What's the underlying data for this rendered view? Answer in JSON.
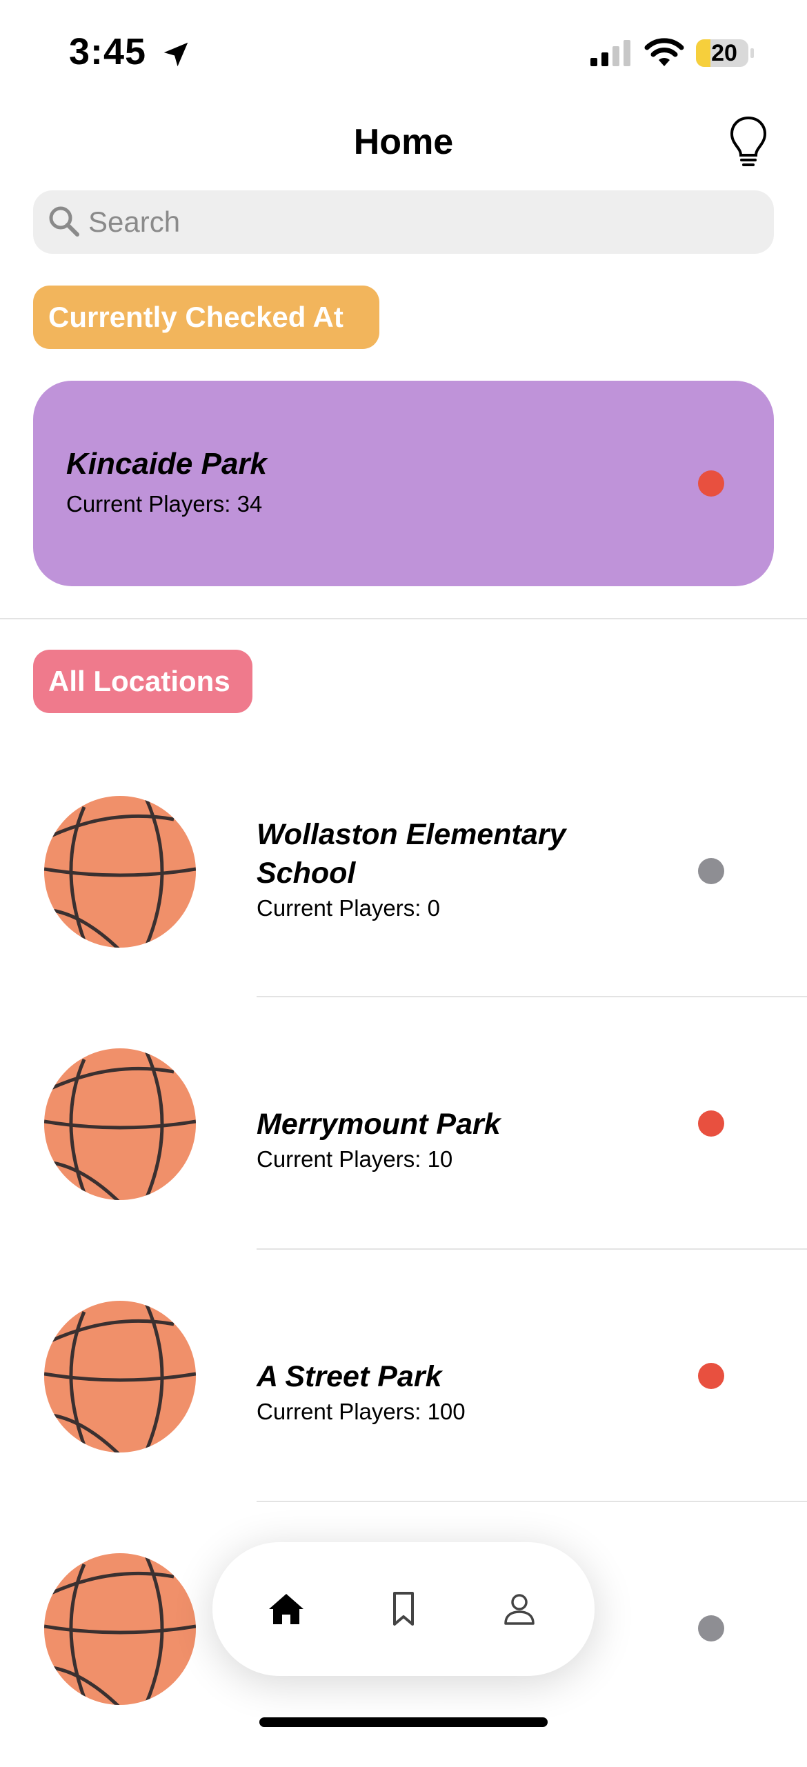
{
  "status_bar": {
    "time": "3:45",
    "battery": "20"
  },
  "header": {
    "title": "Home"
  },
  "search": {
    "placeholder": "Search"
  },
  "current": {
    "tag": "Currently Checked At",
    "name": "Kincaide Park",
    "players": "Current Players: 34",
    "status_color": "#e8503f"
  },
  "all_tag": "All Locations",
  "locations": [
    {
      "name": "Wollaston Elementary School",
      "players": "Current Players: 0",
      "status_color": "#8e8e93"
    },
    {
      "name": "Merrymount Park",
      "players": "Current Players: 10",
      "status_color": "#e8503f"
    },
    {
      "name": "A Street Park",
      "players": "Current Players: 100",
      "status_color": "#e8503f"
    },
    {
      "name": "",
      "players": "",
      "status_color": "#8e8e93"
    }
  ],
  "tabbar": {
    "items": [
      "home-icon",
      "bookmark-icon",
      "person-icon"
    ],
    "active": "home-icon"
  },
  "colors": {
    "accent_orange": "#f2b55c",
    "accent_pink": "#ef7a8c",
    "card_purple": "#bf93d9"
  }
}
